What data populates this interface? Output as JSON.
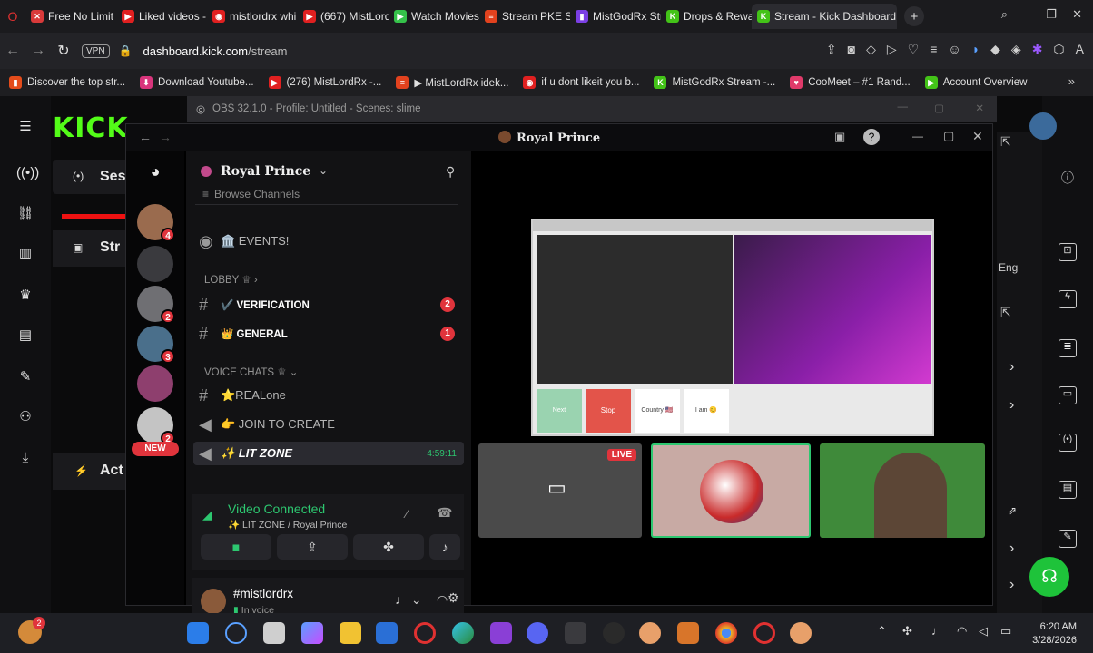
{
  "tabs": [
    {
      "label": "Free No Limit",
      "color": "#d93a3a",
      "glyph": "✕"
    },
    {
      "label": "Liked videos -",
      "color": "#e02020",
      "glyph": "▶"
    },
    {
      "label": "mistlordrx whi",
      "color": "#e02020",
      "glyph": "◉"
    },
    {
      "label": "(667) MistLord",
      "color": "#e02020",
      "glyph": "▶"
    },
    {
      "label": "Watch Movies",
      "color": "#35c24a",
      "glyph": "▶"
    },
    {
      "label": "Stream PKE Sl",
      "color": "#e2421e",
      "glyph": "≡"
    },
    {
      "label": "MistGodRx Str",
      "color": "#7b3fe4",
      "glyph": "▮"
    },
    {
      "label": "Drops & Rewa",
      "color": "#43c318",
      "glyph": "K"
    },
    {
      "label": "Stream - Kick Dashboard",
      "color": "#43c318",
      "glyph": "K",
      "active": true
    }
  ],
  "address": {
    "vpn": "VPN",
    "domain": "dashboard.kick.com",
    "path": "/stream"
  },
  "bookmarks": [
    {
      "label": "Discover the top str...",
      "color": "#e44c1b",
      "glyph": "▮"
    },
    {
      "label": "Download Youtube...",
      "color": "#d8357c",
      "glyph": "⬇"
    },
    {
      "label": "(276) MistLordRx -...",
      "color": "#e02020",
      "glyph": "▶"
    },
    {
      "label": "▶ MistLordRx idek...",
      "color": "#e2421e",
      "glyph": "≡"
    },
    {
      "label": "if u dont likeit you b...",
      "color": "#e02020",
      "glyph": "◉"
    },
    {
      "label": "MistGodRx Stream -...",
      "color": "#43c318",
      "glyph": "K"
    },
    {
      "label": "CooMeet – #1 Rand...",
      "color": "#e03a6a",
      "glyph": "♥"
    },
    {
      "label": "Account Overview",
      "color": "#43c318",
      "glyph": "▶"
    }
  ],
  "kick": {
    "logo": "KICK",
    "session_label": "Ses",
    "stream_label": "Str",
    "activity_label": "Act",
    "lang": "Eng"
  },
  "obs": {
    "title": "OBS 32.1.0 - Profile: Untitled - Scenes: slime"
  },
  "discord": {
    "window_title": "Royal Prince",
    "server_name": "Royal Prince",
    "browse": "Browse Channels",
    "events": "🏛️ EVENTS!",
    "lobby": "LOBBY ♕",
    "channels": [
      {
        "label": "✔️ VERIFICATION",
        "count": "2"
      },
      {
        "label": "👑 GENERAL",
        "count": "1"
      }
    ],
    "voice_cat": "VOICE CHATS ♕",
    "voice_channels": [
      {
        "label": "⭐REALone"
      },
      {
        "label": "👉 JOIN TO CREATE"
      },
      {
        "label": "✨ LIT ZONE",
        "time": "4:59:11"
      }
    ],
    "new_badge": "NEW",
    "server_badges": [
      "4",
      "2",
      "3",
      "2"
    ],
    "voice_status": "Video Connected",
    "voice_sub": "✨ LIT ZONE / Royal Prince",
    "username": "#mistlordrx",
    "user_status": "In voice",
    "live_badge": "LIVE"
  },
  "screen_buttons": [
    "Next",
    "Stop",
    "Country 🇺🇸",
    "I am 😊"
  ],
  "clock": {
    "time": "6:20 AM",
    "date": "3/28/2026"
  },
  "taskbar_badge": "2"
}
